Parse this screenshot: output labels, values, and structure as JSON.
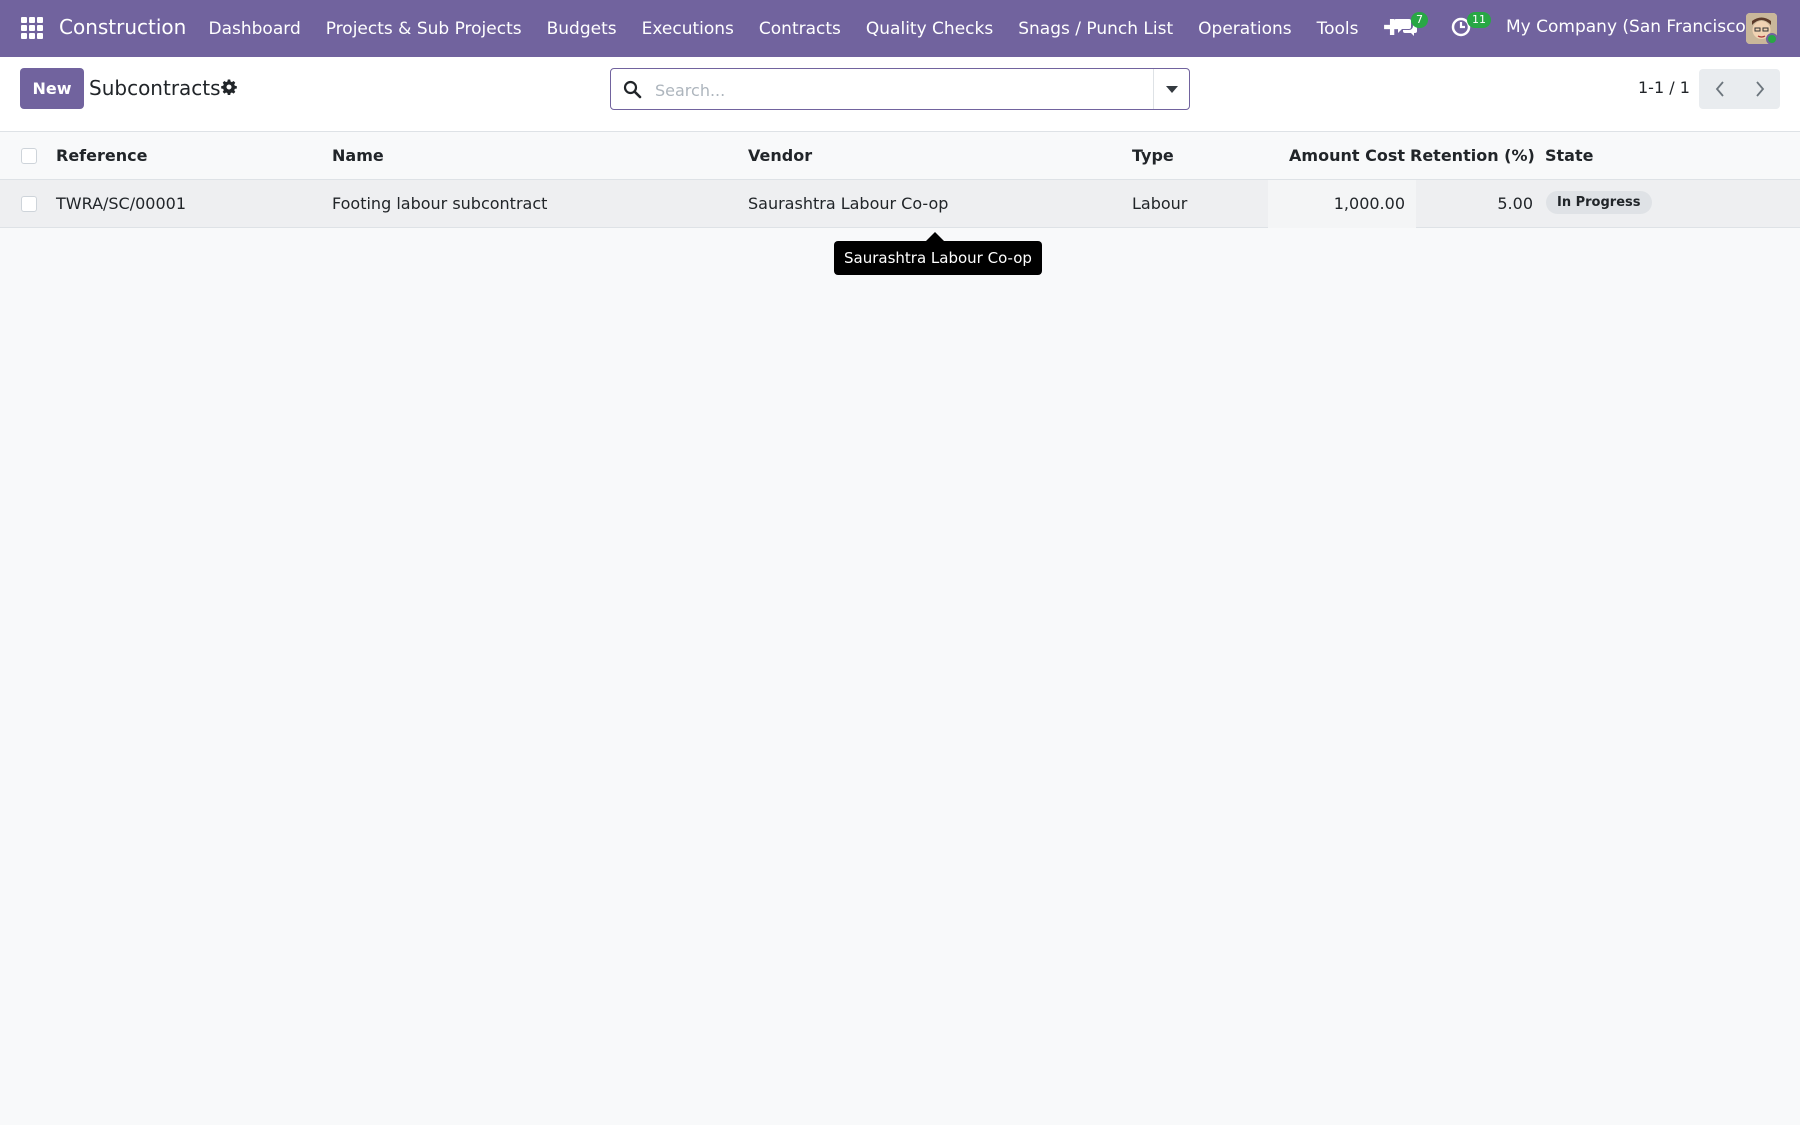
{
  "navbar": {
    "brand": "Construction",
    "menu": [
      "Dashboard",
      "Projects & Sub Projects",
      "Budgets",
      "Executions",
      "Contracts",
      "Quality Checks",
      "Snags / Punch List",
      "Operations",
      "Tools"
    ],
    "chat_count": "7",
    "activity_count": "11",
    "company": "My Company (San Francisco)"
  },
  "control_panel": {
    "new_label": "New",
    "title": "Subcontracts",
    "search_placeholder": "Search...",
    "pager": "1-1 / 1"
  },
  "table": {
    "headers": {
      "reference": "Reference",
      "name": "Name",
      "vendor": "Vendor",
      "type": "Type",
      "amount_cost": "Amount Cost",
      "retention": "Retention (%)",
      "state": "State"
    },
    "rows": [
      {
        "reference": "TWRA/SC/00001",
        "name": "Footing labour subcontract",
        "vendor": "Saurashtra Labour Co-op",
        "type": "Labour",
        "amount_cost": "1,000.00",
        "retention": "5.00",
        "state": "In Progress"
      }
    ]
  },
  "tooltip": {
    "text": "Saurashtra Labour Co-op"
  },
  "colors": {
    "brand": "#71639e",
    "badge_green": "#28a745"
  }
}
